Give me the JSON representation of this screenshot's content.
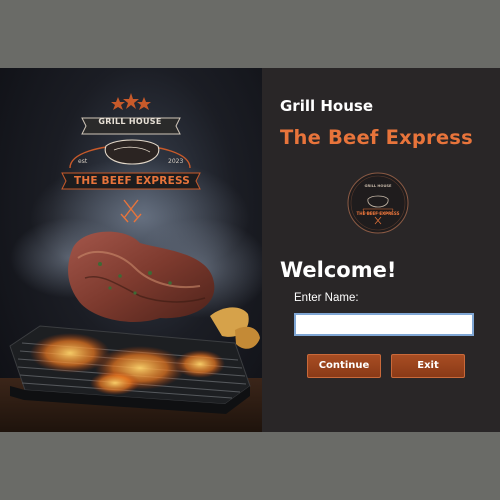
{
  "hero": {
    "logo_top": "GRILL HOUSE",
    "logo_est": "est",
    "logo_year": "2023",
    "logo_bottom": "THE BEEF EXPRESS"
  },
  "panel": {
    "app_name": "Grill House",
    "brand": "The Beef Express",
    "badge_top": "GRILL HOUSE",
    "badge_bottom": "THE BEEF EXPRESS",
    "welcome": "Welcome!",
    "name_label": "Enter Name:",
    "name_value": "",
    "continue_label": "Continue",
    "exit_label": "Exit"
  },
  "colors": {
    "accent": "#e8743b",
    "button": "#9b4520",
    "panel_bg": "#292627",
    "outer_bg": "#6a6b67"
  },
  "icons": [
    "logo-icon",
    "fork-knife-icon",
    "stars-icon",
    "badge-logo-icon"
  ]
}
